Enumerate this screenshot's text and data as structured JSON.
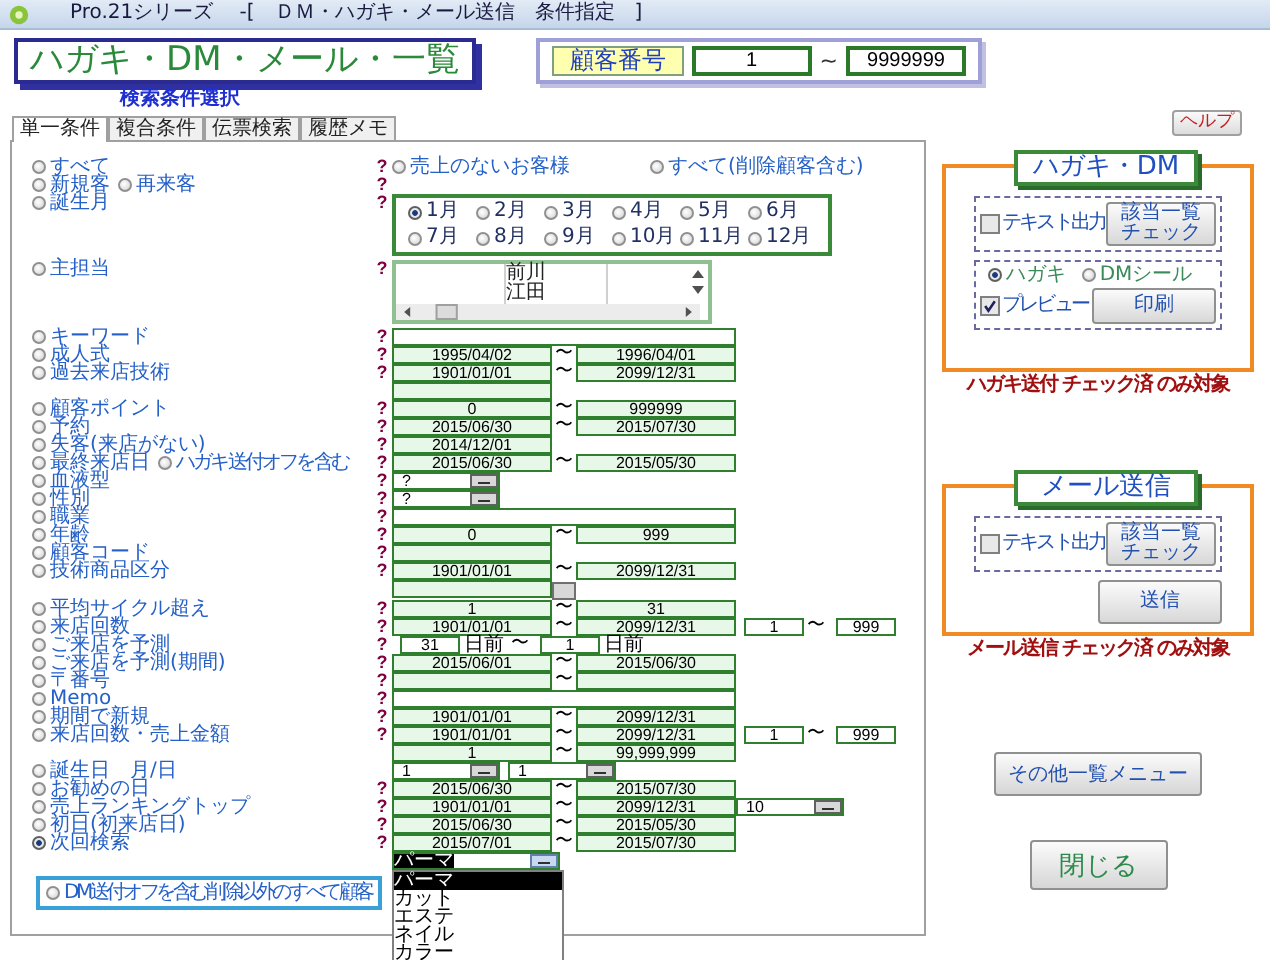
{
  "window": {
    "title": "Pro.21シリーズ　 -[　ＤＭ・ハガキ・メール送信　条件指定　]"
  },
  "header": {
    "title": "ハガキ・DM・メール・一覧",
    "subtitle": "検索条件選択",
    "customer_number": {
      "label": "顧客番号",
      "from": "1",
      "separator": "~",
      "to": "9999999"
    }
  },
  "help_button": "ヘルプ",
  "tabs": [
    {
      "label": "単一条件",
      "selected": true
    },
    {
      "label": "複合条件",
      "selected": false
    },
    {
      "label": "伝票検索",
      "selected": false
    },
    {
      "label": "履歴メモ",
      "selected": false
    }
  ],
  "conditions": [
    {
      "label": "すべて",
      "selected": false,
      "help": "?",
      "controls": [
        {
          "kind": "radio",
          "label": "売上のないお客様",
          "selected": false
        },
        {
          "kind": "radio",
          "label": "すべて(削除顧客含む)",
          "selected": false
        }
      ]
    },
    {
      "label": "新規客",
      "selected": false,
      "extra": {
        "label": "再来客",
        "selected": false
      },
      "help": "?"
    },
    {
      "label": "誕生月",
      "selected": false,
      "help": "?",
      "controls": [
        {
          "kind": "months",
          "items": [
            {
              "label": "1月",
              "selected": true
            },
            {
              "label": "2月",
              "selected": false
            },
            {
              "label": "3月",
              "selected": false
            },
            {
              "label": "4月",
              "selected": false
            },
            {
              "label": "5月",
              "selected": false
            },
            {
              "label": "6月",
              "selected": false
            },
            {
              "label": "7月",
              "selected": false
            },
            {
              "label": "8月",
              "selected": false
            },
            {
              "label": "9月",
              "selected": false
            },
            {
              "label": "10月",
              "selected": false
            },
            {
              "label": "11月",
              "selected": false
            },
            {
              "label": "12月",
              "selected": false
            }
          ]
        }
      ]
    },
    {
      "label": "主担当",
      "selected": false,
      "help": "?",
      "controls": [
        {
          "kind": "listbox",
          "items": [
            "前川",
            "江田"
          ]
        }
      ]
    },
    {
      "label": "キーワード",
      "selected": false,
      "help": "?",
      "controls": [
        {
          "kind": "wide"
        }
      ]
    },
    {
      "label": "成人式",
      "selected": false,
      "help": "?",
      "controls": [
        {
          "kind": "field",
          "value": "1995/04/02"
        },
        {
          "kind": "tilde",
          "text": "〜"
        },
        {
          "kind": "field",
          "value": "1996/04/01"
        }
      ]
    },
    {
      "label": "過去来店技術",
      "selected": false,
      "help": "?",
      "controls": [
        {
          "kind": "field",
          "value": "1901/01/01"
        },
        {
          "kind": "tilde",
          "text": "〜"
        },
        {
          "kind": "field",
          "value": "2099/12/31"
        }
      ]
    },
    {
      "controls": [
        {
          "kind": "field"
        }
      ]
    },
    {
      "label": "顧客ポイント",
      "selected": false,
      "help": "?",
      "controls": [
        {
          "kind": "field",
          "value": "0"
        },
        {
          "kind": "tilde",
          "text": "〜"
        },
        {
          "kind": "field",
          "value": "999999"
        }
      ]
    },
    {
      "label": "予約",
      "selected": false,
      "help": "?",
      "controls": [
        {
          "kind": "field",
          "value": "2015/06/30"
        },
        {
          "kind": "tilde",
          "text": "〜"
        },
        {
          "kind": "field",
          "value": "2015/07/30"
        }
      ]
    },
    {
      "label": "失客(来店がない)",
      "selected": false,
      "help": "?",
      "controls": [
        {
          "kind": "field",
          "value": "2014/12/01"
        }
      ]
    },
    {
      "label": "最終来店日",
      "selected": false,
      "extra": {
        "label": "ハガキ送付オフを含む",
        "selected": false
      },
      "help": "?",
      "controls": [
        {
          "kind": "field",
          "value": "2015/06/30"
        },
        {
          "kind": "tilde",
          "text": "〜"
        },
        {
          "kind": "field",
          "value": "2015/05/30"
        }
      ]
    },
    {
      "label": "血液型",
      "selected": false,
      "help": "?",
      "controls": [
        {
          "kind": "combo",
          "value": "?"
        }
      ]
    },
    {
      "label": "性別",
      "selected": false,
      "help": "?",
      "controls": [
        {
          "kind": "combo",
          "value": "?"
        }
      ]
    },
    {
      "label": "職業",
      "selected": false,
      "help": "?",
      "controls": [
        {
          "kind": "wide"
        }
      ]
    },
    {
      "label": "年齢",
      "selected": false,
      "help": "?",
      "controls": [
        {
          "kind": "field",
          "value": "0"
        },
        {
          "kind": "tilde",
          "text": "〜"
        },
        {
          "kind": "field",
          "value": "999"
        }
      ]
    },
    {
      "label": "顧客コード",
      "selected": false,
      "help": "?",
      "controls": [
        {
          "kind": "field"
        }
      ]
    },
    {
      "label": "技術商品区分",
      "selected": false,
      "help": "?",
      "controls": [
        {
          "kind": "field",
          "value": "1901/01/01"
        },
        {
          "kind": "tilde",
          "text": "〜"
        },
        {
          "kind": "field",
          "value": "2099/12/31"
        }
      ]
    },
    {
      "controls": [
        {
          "kind": "field"
        },
        {
          "kind": "button"
        }
      ]
    },
    {
      "label": "平均サイクル超え",
      "selected": false,
      "help": "?",
      "controls": [
        {
          "kind": "field",
          "value": "1"
        },
        {
          "kind": "tilde",
          "text": "〜"
        },
        {
          "kind": "field",
          "value": "31"
        }
      ]
    },
    {
      "label": "来店回数",
      "selected": false,
      "help": "?",
      "controls": [
        {
          "kind": "field",
          "value": "1901/01/01"
        },
        {
          "kind": "tilde",
          "text": "〜"
        },
        {
          "kind": "field",
          "value": "2099/12/31"
        },
        {
          "kind": "small",
          "value": "1"
        },
        {
          "kind": "tilde",
          "text": "〜"
        },
        {
          "kind": "small",
          "value": "999"
        }
      ]
    },
    {
      "label": "ご来店を予測",
      "selected": false,
      "help": "?",
      "controls": [
        {
          "kind": "small",
          "value": "31"
        },
        {
          "kind": "text",
          "text": "日前"
        },
        {
          "kind": "tilde",
          "text": "〜"
        },
        {
          "kind": "small",
          "value": "1"
        },
        {
          "kind": "text",
          "text": "日前"
        }
      ]
    },
    {
      "label": "ご来店を予測(期間)",
      "selected": false,
      "help": "?",
      "controls": [
        {
          "kind": "field",
          "value": "2015/06/01"
        },
        {
          "kind": "tilde",
          "text": "〜"
        },
        {
          "kind": "field",
          "value": "2015/06/30"
        }
      ]
    },
    {
      "label": "〒番号",
      "selected": false,
      "help": "?",
      "controls": [
        {
          "kind": "field"
        },
        {
          "kind": "tilde",
          "text": "〜"
        },
        {
          "kind": "field"
        }
      ]
    },
    {
      "label": "Memo",
      "selected": false,
      "help": "?",
      "controls": [
        {
          "kind": "wide"
        }
      ]
    },
    {
      "label": "期間で新規",
      "selected": false,
      "help": "?",
      "controls": [
        {
          "kind": "field",
          "value": "1901/01/01"
        },
        {
          "kind": "tilde",
          "text": "〜"
        },
        {
          "kind": "field",
          "value": "2099/12/31"
        }
      ]
    },
    {
      "label": "来店回数・売上金額",
      "selected": false,
      "help": "?",
      "controls": [
        {
          "kind": "field",
          "value": "1901/01/01"
        },
        {
          "kind": "tilde",
          "text": "〜"
        },
        {
          "kind": "field",
          "value": "2099/12/31"
        },
        {
          "kind": "small",
          "value": "1"
        },
        {
          "kind": "tilde",
          "text": "〜"
        },
        {
          "kind": "small",
          "value": "999"
        }
      ]
    },
    {
      "controls": [
        {
          "kind": "field",
          "value": "1"
        },
        {
          "kind": "tilde",
          "text": "〜"
        },
        {
          "kind": "field",
          "value": "99,999,999"
        }
      ]
    },
    {
      "label": "誕生日　月/日",
      "selected": false,
      "controls": [
        {
          "kind": "combo",
          "value": "1"
        },
        {
          "kind": "combo",
          "value": "1"
        }
      ]
    },
    {
      "label": "お勧めの日",
      "selected": false,
      "help": "?",
      "controls": [
        {
          "kind": "field",
          "value": "2015/06/30"
        },
        {
          "kind": "tilde",
          "text": "〜"
        },
        {
          "kind": "field",
          "value": "2015/07/30"
        }
      ]
    },
    {
      "label": "売上ランキングトップ",
      "selected": false,
      "help": "?",
      "controls": [
        {
          "kind": "field",
          "value": "1901/01/01"
        },
        {
          "kind": "tilde",
          "text": "〜"
        },
        {
          "kind": "field",
          "value": "2099/12/31"
        },
        {
          "kind": "combo",
          "value": "10"
        }
      ]
    },
    {
      "label": "初日(初来店日)",
      "selected": false,
      "help": "?",
      "controls": [
        {
          "kind": "field",
          "value": "2015/06/30"
        },
        {
          "kind": "tilde",
          "text": "〜"
        },
        {
          "kind": "field",
          "value": "2015/05/30"
        }
      ]
    },
    {
      "label": "次回検索",
      "selected": true,
      "help": "?",
      "controls": [
        {
          "kind": "field",
          "value": "2015/07/01"
        },
        {
          "kind": "tilde",
          "text": "〜"
        },
        {
          "kind": "field",
          "value": "2015/07/30"
        }
      ]
    }
  ],
  "menu_dropdown": {
    "value": "パーマ",
    "expanded": true,
    "options": [
      {
        "label": "パーマ",
        "selected": true
      },
      {
        "label": "カット",
        "selected": false
      },
      {
        "label": "エステ",
        "selected": false
      },
      {
        "label": "ネイル",
        "selected": false
      },
      {
        "label": "カラー",
        "selected": false
      }
    ]
  },
  "all_customers_option": {
    "label": "DM送付オフを含む削除以外のすべて顧客",
    "selected": false
  },
  "postcard_group": {
    "title": "ハガキ・DM",
    "text_output": {
      "label": "テキスト出力",
      "checked": false
    },
    "check_button": "該当一覧チェック",
    "types": [
      {
        "label": "ハガキ",
        "selected": true
      },
      {
        "label": "DMシール",
        "selected": false
      }
    ],
    "preview": {
      "label": "プレビュー",
      "checked": true
    },
    "print_button": "印刷",
    "note": "ハガキ送付 チェック済 のみ対象"
  },
  "mail_group": {
    "title": "メール送信",
    "text_output": {
      "label": "テキスト出力",
      "checked": false
    },
    "check_button": "該当一覧チェック",
    "send_button": "送信",
    "note": "メール送信 チェック済 のみ対象"
  },
  "menu_button": "その他一覧メニュー",
  "close_button": "閉じる"
}
